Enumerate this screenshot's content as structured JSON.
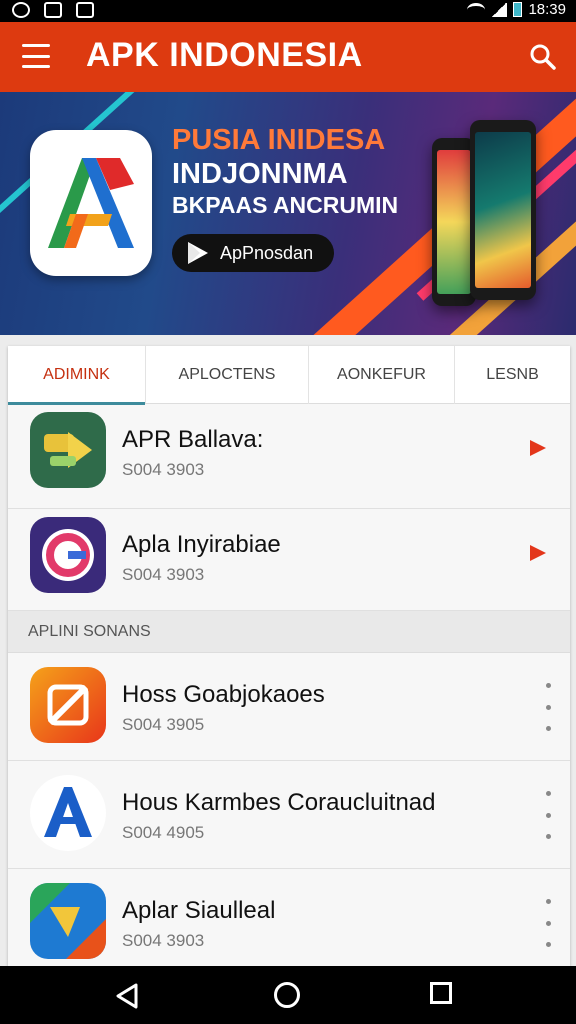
{
  "status_bar": {
    "time": "18:39"
  },
  "app_bar": {
    "title": "APK INDONESIA",
    "menu_icon": "hamburger-menu-icon",
    "search_icon": "search-icon"
  },
  "banner": {
    "line1": "PUSIA INIDESA",
    "line2": "INDJONNMA",
    "line3": "BKPAAS ANCRUMIN",
    "store_button": "ApPnosdan",
    "colors": {
      "background": "#214a8a",
      "accent": "#ff5a1f",
      "line1": "#ff7a3a"
    }
  },
  "tabs": [
    {
      "label": "ADIMINK",
      "active": true
    },
    {
      "label": "APLOCTENS",
      "active": false
    },
    {
      "label": "AONKEFUR",
      "active": false
    },
    {
      "label": "LESNB",
      "active": false
    }
  ],
  "featured_apps": [
    {
      "name": "APR Ballava:",
      "size": "S004 3903",
      "action_icon": "play-arrow-icon"
    },
    {
      "name": "Apla Inyirabiae",
      "size": "S004 3903",
      "action_icon": "play-arrow-icon"
    }
  ],
  "section": {
    "title": "APLINI SONANS"
  },
  "apps": [
    {
      "name": "Hoss Goabjokaoes",
      "size": "S004 3905",
      "action_icon": "more-vertical-icon"
    },
    {
      "name": "Hous Karmbes Coraucluitnad",
      "size": "S004 4905",
      "action_icon": "more-vertical-icon"
    },
    {
      "name": "Aplar Siaulleal",
      "size": "S004 3903",
      "action_icon": "more-vertical-icon"
    }
  ],
  "theme": {
    "primary": "#dd3a10",
    "tab_indicator": "#3d8b9c",
    "play": "#e3361a"
  }
}
